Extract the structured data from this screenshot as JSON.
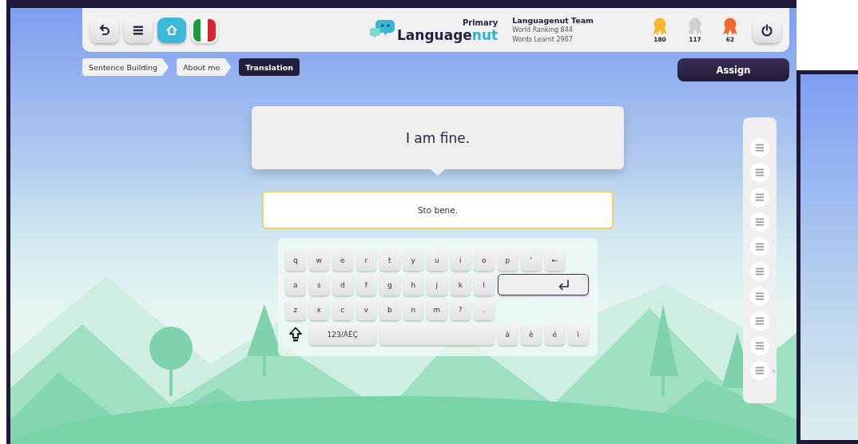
{
  "toolbar": {
    "buttons": [
      {
        "kind": "undo"
      },
      {
        "kind": "menu"
      },
      {
        "kind": "home",
        "selected": true
      },
      {
        "kind": "flag"
      }
    ]
  },
  "logo": {
    "tier": "Primary",
    "wordmark": [
      "Language",
      "nut"
    ]
  },
  "user": {
    "name": "Languagenut Team",
    "ranking": "World Ranking 844",
    "words": "Words Learnt 2967"
  },
  "medals": [
    {
      "color": "#f7b529",
      "count": "180"
    },
    {
      "color": "#cfcfcf",
      "count": "117"
    },
    {
      "color": "#f2672c",
      "count": "62"
    }
  ],
  "breadcrumbs": [
    {
      "label": "Sentence Building",
      "selected": false
    },
    {
      "label": "About me",
      "selected": false
    },
    {
      "label": "Translation",
      "selected": true
    }
  ],
  "assign_button": "Assign",
  "prompt": "I am fine.",
  "answer": {
    "value": "Sto bene."
  },
  "keyboard": {
    "rows": [
      [
        {
          "kind": "char",
          "label": "q"
        },
        {
          "kind": "char",
          "label": "w"
        },
        {
          "kind": "char",
          "label": "e"
        },
        {
          "kind": "char",
          "label": "r"
        },
        {
          "kind": "char",
          "label": "t"
        },
        {
          "kind": "char",
          "label": "y"
        },
        {
          "kind": "char",
          "label": "u"
        },
        {
          "kind": "char",
          "label": "i"
        },
        {
          "kind": "char",
          "label": "o"
        },
        {
          "kind": "char",
          "label": "p"
        },
        {
          "kind": "char",
          "label": "'"
        },
        {
          "kind": "char",
          "label": "←"
        }
      ],
      [
        {
          "kind": "char",
          "label": "a"
        },
        {
          "kind": "char",
          "label": "s"
        },
        {
          "kind": "char",
          "label": "d"
        },
        {
          "kind": "char",
          "label": "f"
        },
        {
          "kind": "char",
          "label": "g"
        },
        {
          "kind": "char",
          "label": "h"
        },
        {
          "kind": "char",
          "label": "j"
        },
        {
          "kind": "char",
          "label": "k"
        },
        {
          "kind": "char",
          "label": "l"
        },
        {
          "kind": "enter"
        }
      ],
      [
        {
          "kind": "char",
          "label": "z"
        },
        {
          "kind": "char",
          "label": "x"
        },
        {
          "kind": "char",
          "label": "c"
        },
        {
          "kind": "char",
          "label": "v"
        },
        {
          "kind": "char",
          "label": "b"
        },
        {
          "kind": "char",
          "label": "n"
        },
        {
          "kind": "char",
          "label": "m"
        },
        {
          "kind": "char",
          "label": "?"
        },
        {
          "kind": "char",
          "label": "."
        }
      ]
    ],
    "bottom_row": {
      "mode_key": "123/ÀÉÇ",
      "accent_keys": [
        "à",
        "è",
        "é",
        "ì"
      ]
    }
  },
  "sidebar": {
    "collapse_handle": "‹"
  }
}
